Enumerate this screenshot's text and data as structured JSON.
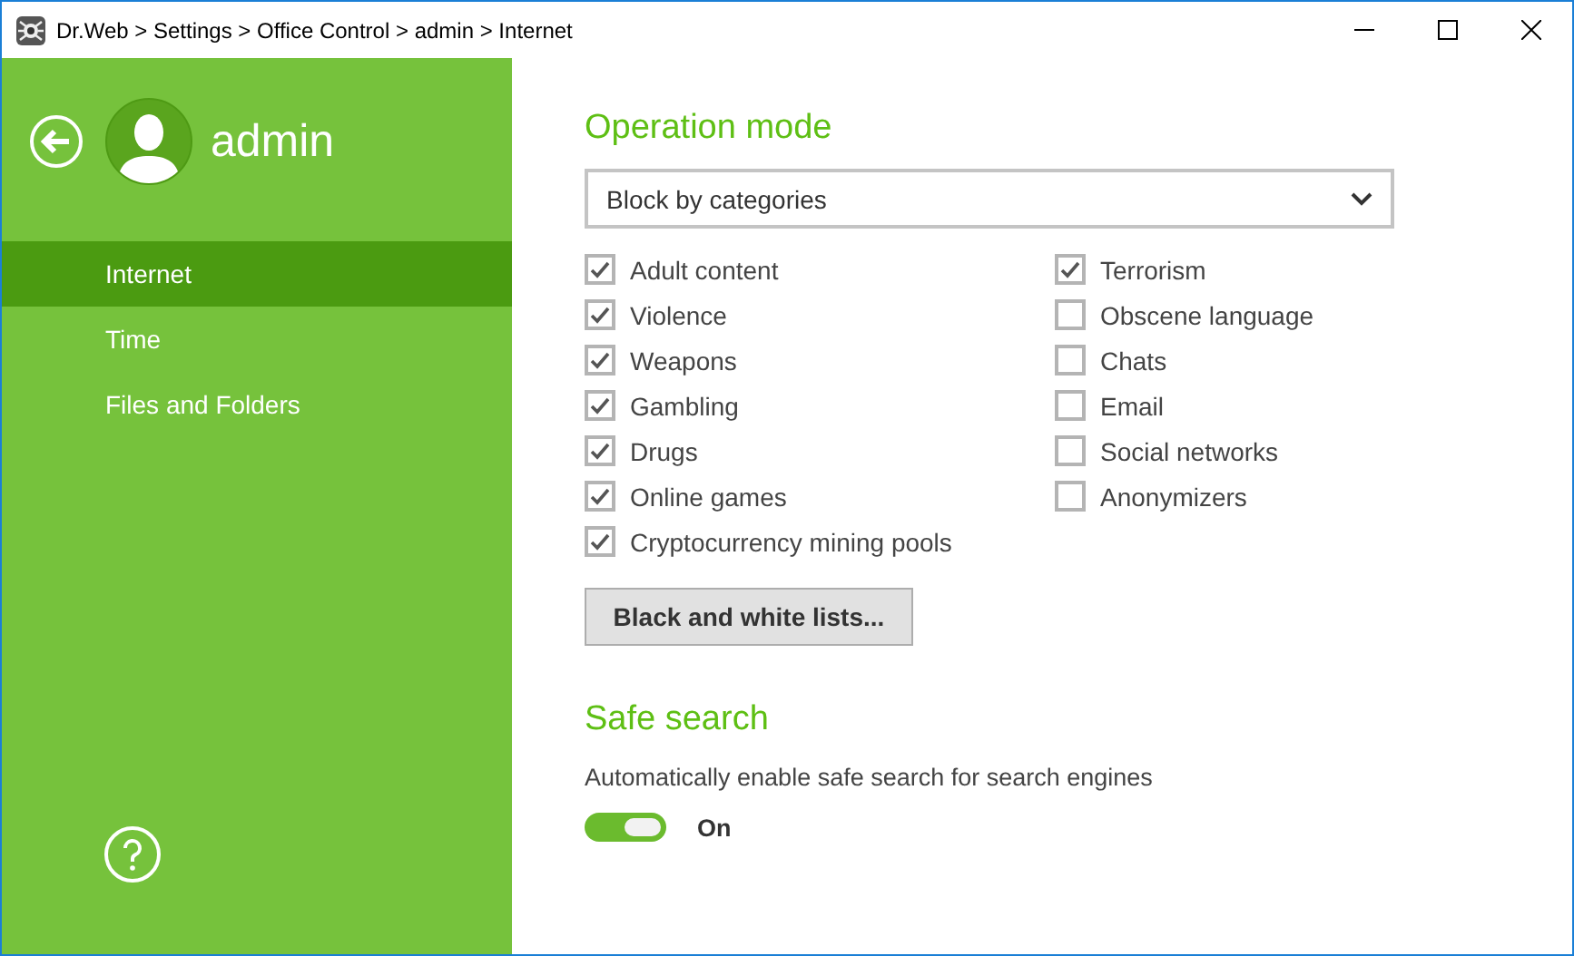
{
  "window": {
    "title": "Dr.Web > Settings > Office Control > admin > Internet"
  },
  "sidebar": {
    "user": "admin",
    "items": [
      {
        "label": "Internet",
        "selected": true
      },
      {
        "label": "Time",
        "selected": false
      },
      {
        "label": "Files and Folders",
        "selected": false
      }
    ]
  },
  "operation_mode": {
    "title": "Operation mode",
    "dropdown": "Block by categories",
    "categories": [
      [
        {
          "label": "Adult content",
          "checked": true
        },
        {
          "label": "Violence",
          "checked": true
        },
        {
          "label": "Weapons",
          "checked": true
        },
        {
          "label": "Gambling",
          "checked": true
        },
        {
          "label": "Drugs",
          "checked": true
        },
        {
          "label": "Online games",
          "checked": true
        },
        {
          "label": "Cryptocurrency mining pools",
          "checked": true
        }
      ],
      [
        {
          "label": "Terrorism",
          "checked": true
        },
        {
          "label": "Obscene language",
          "checked": false
        },
        {
          "label": "Chats",
          "checked": false
        },
        {
          "label": "Email",
          "checked": false
        },
        {
          "label": "Social networks",
          "checked": false
        },
        {
          "label": "Anonymizers",
          "checked": false
        }
      ]
    ],
    "button": "Black and white lists..."
  },
  "safe_search": {
    "title": "Safe search",
    "description": "Automatically enable safe search for search engines",
    "toggle": {
      "on": true,
      "label": "On"
    }
  }
}
